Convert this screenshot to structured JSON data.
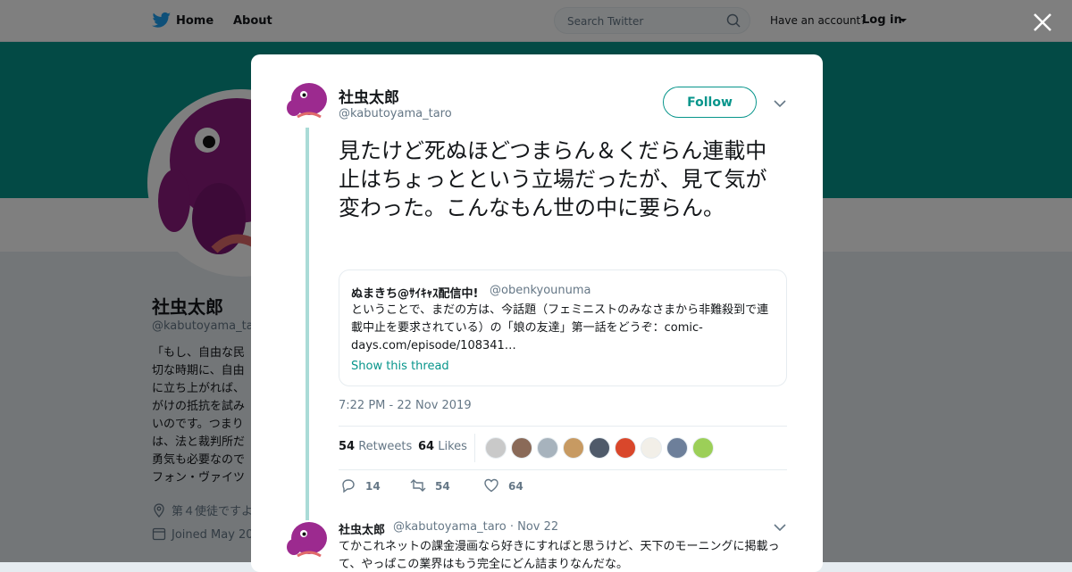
{
  "nav": {
    "home_label": "Home",
    "about_label": "About",
    "search_placeholder": "Search Twitter",
    "have_account": "Have an account?",
    "login_label": "Log in"
  },
  "profile": {
    "name": "社虫太郎",
    "handle": "@kabutoyama_ta",
    "bio_lines": [
      "「もし、自由な民",
      "切な時期に、自由",
      "に立ち上がれば、",
      "がけの抵抗を試み",
      "いのです。つまり",
      "は、法と裁判所だ",
      "勇気も必要なので",
      "フォン・ヴァイツ"
    ],
    "location": "第４使徒ですよ",
    "joined": "Joined May 20"
  },
  "tweet": {
    "author_name": "社虫太郎",
    "author_handle": "@kabutoyama_taro",
    "follow_label": "Follow",
    "text": "見たけど死ぬほどつまらん＆くだらん連載中止はちょっとという立場だったが、見て気が変わった。こんなもん世の中に要らん。",
    "quote": {
      "name": "ぬまきち@ｻｲｷｬｽ配信中!",
      "handle": "@obenkyounuma",
      "text": "ということで、まだの方は、今話題（フェミニストのみなさまから非難殺到で連載中止を要求されている）の「娘の友達」第一話をどうぞ：comic-days.com/episode/108341…",
      "show_thread": "Show this thread"
    },
    "timestamp": "7:22 PM - 22 Nov 2019",
    "retweets_count": "54",
    "retweets_label": "Retweets",
    "likes_count": "64",
    "likes_label": "Likes",
    "likers_colors": [
      "#c9c9c9",
      "#8a6a58",
      "#a7b3bd",
      "#c79a62",
      "#4f5a6a",
      "#d9472b",
      "#f2efe8",
      "#6d7f9a",
      "#9ccf58"
    ],
    "actions": {
      "replies": "14",
      "retweets": "54",
      "likes": "64"
    }
  },
  "reply": {
    "author_name": "社虫太郎",
    "author_handle": "@kabutoyama_taro",
    "date": "· Nov 22",
    "text": "てかこれネットの課金漫画なら好きにすればと思うけど、天下のモーニングに掲載って、やっぱこの業界はもう完全にどん詰まりなんだな。"
  },
  "colors": {
    "accent": "#07958b",
    "thread": "#aadbd7",
    "text": "#14171a",
    "muted": "#657786"
  }
}
